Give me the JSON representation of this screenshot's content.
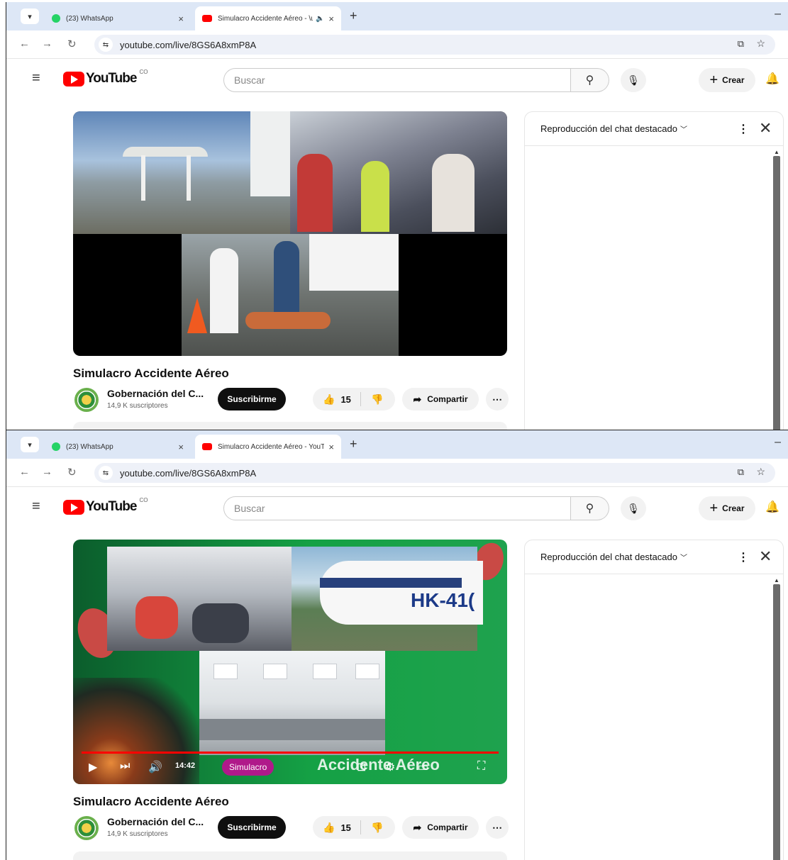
{
  "frames": [
    {
      "tabs": [
        {
          "title": "(23) WhatsApp",
          "icon": "whatsapp-icon"
        },
        {
          "title": "Simulacro Accidente Aéreo - \\u00a0",
          "icon": "youtube-icon"
        }
      ],
      "address": {
        "url": "youtube.com/live/8GS6A8xmP8A"
      },
      "header": {
        "logo_text": "YouTube",
        "country": "CO",
        "search_placeholder": "Buscar",
        "create_label": "Crear"
      },
      "video": {
        "title": "Simulacro Accidente Aéreo",
        "controls_visible": false
      },
      "channel": {
        "name": "Gobernación del C...",
        "subscribers": "14,9 K suscriptores",
        "subscribe_label": "Suscribirme"
      },
      "actions": {
        "likes": "15",
        "share_label": "Compartir"
      },
      "chat": {
        "title": "Reproducción del chat destacado"
      }
    },
    {
      "tabs": [
        {
          "title": "(23) WhatsApp",
          "icon": "whatsapp-icon"
        },
        {
          "title": "Simulacro Accidente Aéreo - YouT",
          "icon": "youtube-icon"
        }
      ],
      "address": {
        "url": "youtube.com/live/8GS6A8xmP8A"
      },
      "header": {
        "logo_text": "YouTube",
        "country": "CO",
        "search_placeholder": "Buscar",
        "create_label": "Crear"
      },
      "video": {
        "title": "Simulacro Accidente Aéreo",
        "controls_visible": true,
        "time": "14:42",
        "overlay_title": "Simulacro",
        "overlay_big": "Accidente Aéreo",
        "progress": 1.0,
        "aircraft_registration": "HK-41("
      },
      "channel": {
        "name": "Gobernación del C...",
        "subscribers": "14,9 K suscriptores",
        "subscribe_label": "Suscribirme"
      },
      "actions": {
        "likes": "15",
        "share_label": "Compartir"
      },
      "chat": {
        "title": "Reproducción del chat destacado"
      }
    }
  ],
  "colors": {
    "brand_red": "#ff0000",
    "tab_strip": "#dde7f6",
    "subscribe_bg": "#0f0f0f"
  }
}
